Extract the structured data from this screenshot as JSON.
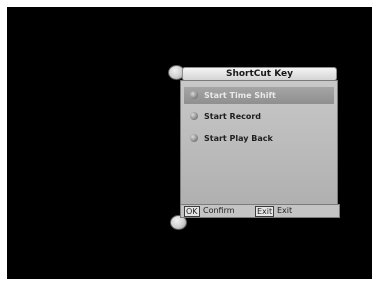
{
  "dialog": {
    "title": "ShortCut Key",
    "items": [
      {
        "label": "Start Time Shift",
        "selected": true
      },
      {
        "label": "Start Record",
        "selected": false
      },
      {
        "label": "Start Play Back",
        "selected": false
      }
    ],
    "footer": {
      "ok_key": "OK",
      "confirm_label": "Confirm",
      "exit_key": "Exit",
      "exit_label": "Exit"
    }
  },
  "colors": {
    "background": "#000000",
    "panel": "#bcbcbc",
    "selected_row": "#9a9a9a"
  }
}
